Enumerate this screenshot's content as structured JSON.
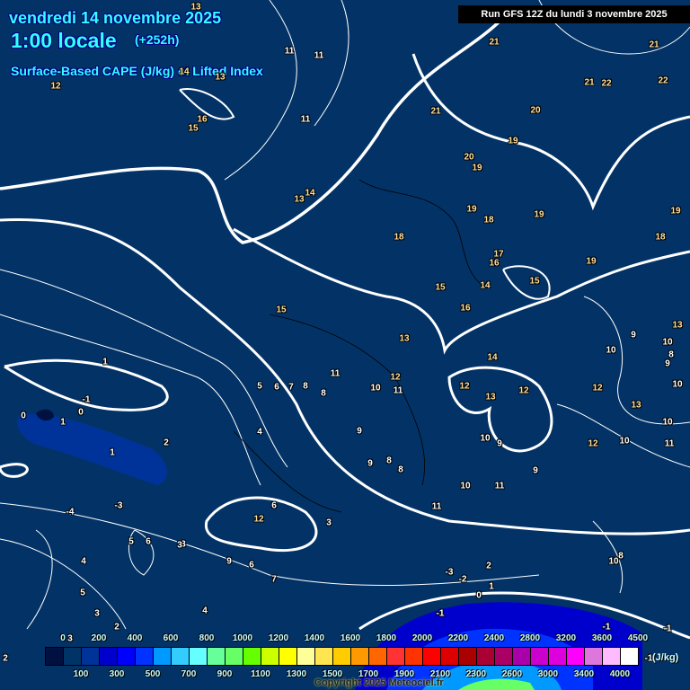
{
  "header": {
    "date": "vendredi 14 novembre 2025",
    "time": "1:00 locale",
    "lead": "(+252h)",
    "parameter": "Surface-Based CAPE (J/kg) et Lifted Index",
    "run": "Run GFS 12Z du lundi 3 novembre 2025"
  },
  "colors": {
    "background": "#033366",
    "title": "#33ffff",
    "contour": "#ffffff"
  },
  "legend": {
    "unit": "(J/kg)",
    "top_ticks": [
      "0",
      "200",
      "400",
      "600",
      "800",
      "1000",
      "1200",
      "1400",
      "1600",
      "1800",
      "2000",
      "2200",
      "2400",
      "2800",
      "3200",
      "3600",
      "4500"
    ],
    "bottom_ticks": [
      "100",
      "300",
      "500",
      "700",
      "900",
      "1100",
      "1300",
      "1500",
      "1700",
      "1900",
      "2100",
      "2300",
      "2600",
      "3000",
      "3400",
      "4000"
    ],
    "swatches": [
      "#001040",
      "#003366",
      "#003399",
      "#0000cc",
      "#0000ff",
      "#0033ff",
      "#0099ff",
      "#33ccff",
      "#66ffff",
      "#66ff99",
      "#66ff66",
      "#66ff00",
      "#ccff00",
      "#ffff00",
      "#ffff99",
      "#ffe650",
      "#ffcc00",
      "#ff9900",
      "#ff6600",
      "#ff3333",
      "#ff3300",
      "#ff0000",
      "#dd0000",
      "#aa0000",
      "#aa0033",
      "#aa0066",
      "#aa00aa",
      "#cc00cc",
      "#dd00dd",
      "#ff00ff",
      "#dd77dd",
      "#ffbbff",
      "#ffffff"
    ]
  },
  "copyright": "Copyright 2025 Meteociel.fr",
  "lifted_index_labels": [
    "13",
    "12",
    "11",
    "11",
    "14",
    "13",
    "16",
    "15",
    "11",
    "13",
    "14",
    "21",
    "21",
    "21",
    "22",
    "22",
    "21",
    "20",
    "19",
    "20",
    "19",
    "19",
    "18",
    "19",
    "19",
    "18",
    "18",
    "17",
    "16",
    "15",
    "14",
    "15",
    "19",
    "16",
    "15",
    "13",
    "13",
    "10",
    "9",
    "10",
    "9",
    "8",
    "10",
    "12",
    "11",
    "12",
    "13",
    "14",
    "12",
    "13",
    "11",
    "10",
    "9",
    "10",
    "11",
    "12",
    "10",
    "11",
    "10",
    "11",
    "12",
    "9",
    "8",
    "8",
    "9",
    "9",
    "8",
    "6",
    "7",
    "5",
    "4",
    "10",
    "8",
    "1",
    "-1",
    "0",
    "1",
    "2",
    "1",
    "0",
    "-4",
    "-3",
    "3",
    "6",
    "5",
    "3",
    "12",
    "6",
    "9",
    "7",
    "6",
    "5",
    "4",
    "3",
    "4",
    "3",
    "2",
    "3",
    "2",
    "-3",
    "-2",
    "-1",
    "0",
    "-1",
    "1",
    "2",
    "10",
    "8",
    "-1",
    "-1"
  ]
}
